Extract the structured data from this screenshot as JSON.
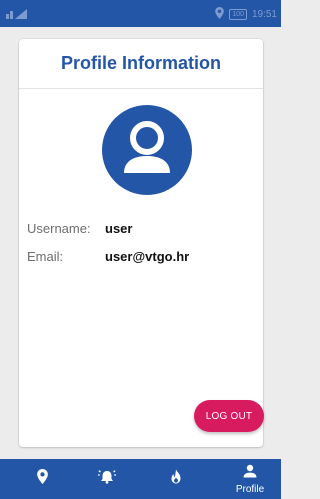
{
  "status_bar": {
    "time": "19:51",
    "battery": "100",
    "icons": [
      "signal-icon",
      "location-icon",
      "battery-icon"
    ]
  },
  "profile": {
    "title": "Profile Information",
    "avatar_icon": "person-avatar-icon",
    "fields": [
      {
        "label": "Username:",
        "value": "user"
      },
      {
        "label": "Email:",
        "value": "user@vtgo.hr"
      }
    ],
    "logout_label": "LOG OUT"
  },
  "bottom_nav": {
    "items": [
      {
        "icon": "location-pin-icon",
        "label": ""
      },
      {
        "icon": "alarm-bell-icon",
        "label": ""
      },
      {
        "icon": "fire-icon",
        "label": ""
      },
      {
        "icon": "person-icon",
        "label": "Profile"
      }
    ]
  },
  "colors": {
    "primary": "#2456a8",
    "accent": "#d81b5e",
    "background": "#ececec",
    "card": "#ffffff"
  }
}
